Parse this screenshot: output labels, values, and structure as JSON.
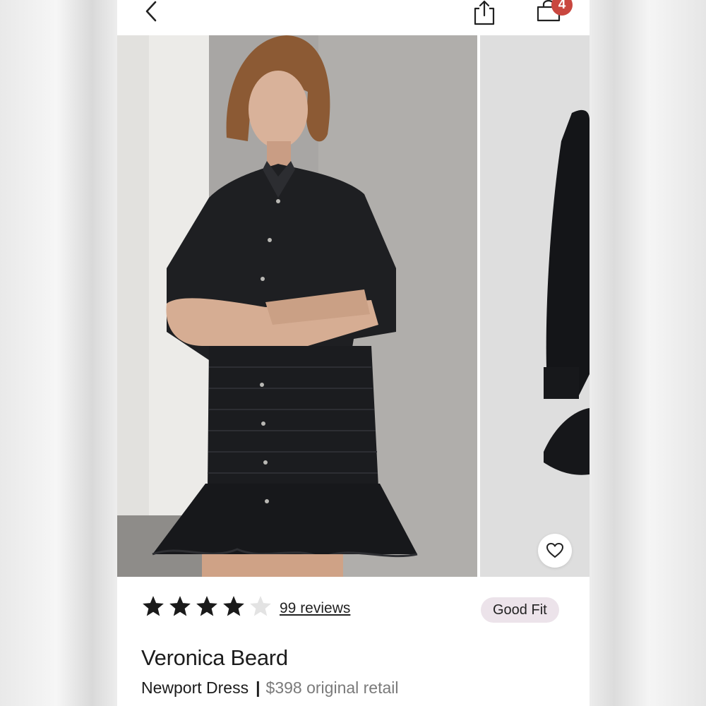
{
  "header": {
    "back_icon": "chevron-left-icon",
    "share_icon": "share-icon",
    "bag_icon": "shopping-bag-icon",
    "bag_count": "4",
    "badge_color": "#c9473f"
  },
  "gallery": {
    "main_image": "model wearing black smocked button-front mini dress",
    "second_image": "black dress laid flat, partial view",
    "like_icon": "heart-icon"
  },
  "rating": {
    "stars_filled": 4,
    "stars_total": 5,
    "reviews_label": "99 reviews"
  },
  "fit_badge": "Good Fit",
  "product": {
    "brand": "Veronica Beard",
    "name": "Newport Dress",
    "separator": "|",
    "price_label": "$398 original retail"
  }
}
